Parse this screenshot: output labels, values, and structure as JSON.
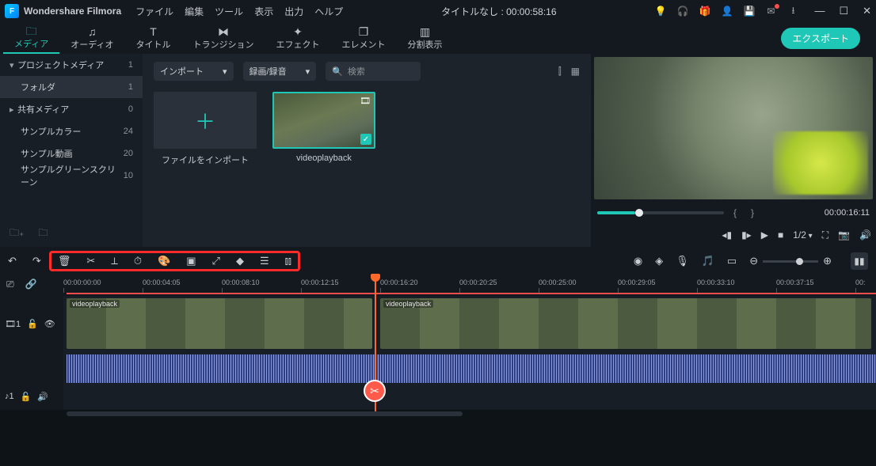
{
  "app": {
    "title": "Wondershare Filmora",
    "doc_title": "タイトルなし : 00:00:58:16"
  },
  "menu": {
    "file": "ファイル",
    "edit": "編集",
    "tool": "ツール",
    "view": "表示",
    "output": "出力",
    "help": "ヘルプ"
  },
  "tabs": {
    "media": "メディア",
    "audio": "オーディオ",
    "title": "タイトル",
    "transition": "トランジション",
    "effect": "エフェクト",
    "element": "エレメント",
    "split": "分割表示",
    "export": "エクスポート"
  },
  "sidebar": {
    "project": {
      "label": "プロジェクトメディア",
      "count": "1"
    },
    "folder": {
      "label": "フォルダ",
      "count": "1"
    },
    "shared": {
      "label": "共有メディア",
      "count": "0"
    },
    "colors": {
      "label": "サンプルカラー",
      "count": "24"
    },
    "videos": {
      "label": "サンプル動画",
      "count": "20"
    },
    "green": {
      "label": "サンプルグリーンスクリーン",
      "count": "10"
    }
  },
  "browser": {
    "import": "インポート",
    "record": "録画/録音",
    "search": "検索",
    "import_tile": "ファイルをインポート",
    "clip_name": "videoplayback"
  },
  "preview": {
    "timecode": "00:00:16:11",
    "rate": "1/2"
  },
  "ruler": [
    "00:00:00:00",
    "00:00:04:05",
    "00:00:08:10",
    "00:00:12:15",
    "00:00:16:20",
    "00:00:20:25",
    "00:00:25:00",
    "00:00:29:05",
    "00:00:33:10",
    "00:00:37:15",
    "00:"
  ],
  "timeline": {
    "clip_label": "videoplayback",
    "track_video": "1",
    "track_audio": "1"
  }
}
